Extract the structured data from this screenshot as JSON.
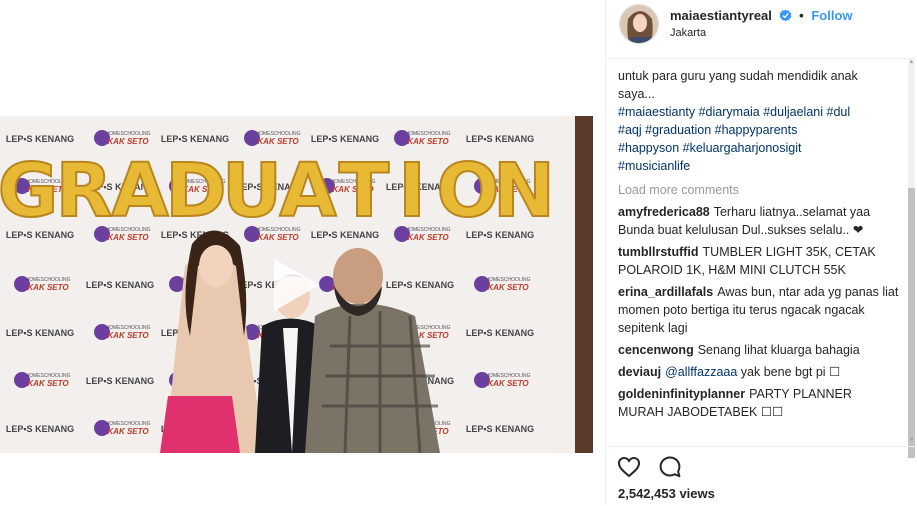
{
  "header": {
    "username": "maiaestiantyreal",
    "separator": "•",
    "follow_label": "Follow",
    "location": "Jakarta"
  },
  "caption": {
    "line1": "untuk para guru yang sudah mendidik anak",
    "line2": "saya...",
    "hashtag_lines": [
      [
        "#maiaestianty",
        "#diarymaia",
        "#duljaelani",
        "#dul"
      ],
      [
        "#aqj",
        "#graduation",
        "#happyparents"
      ],
      [
        "#happyson",
        "#keluargaharjonosigit"
      ],
      [
        "#musicianlife"
      ]
    ]
  },
  "load_more_label": "Load more comments",
  "comments": [
    {
      "user": "amyfrederica88",
      "text": "Terharu liatnya..selamat yaa Bunda buat kelulusan Dul..sukses selalu.. ❤"
    },
    {
      "user": "tumbllrstuffid",
      "text": "TUMBLER LIGHT 35K, CETAK POLAROID 1K, H&M MINI CLUTCH 55K"
    },
    {
      "user": "erina_ardillafals",
      "text": "Awas bun, ntar ada yg panas liat momen poto bertiga itu terus ngacak ngacak sepitenk lagi"
    },
    {
      "user": "cencenwong",
      "text": "Senang lihat kluarga bahagia"
    },
    {
      "user": "deviauj",
      "mention": "@allffazzaaa",
      "text": "yak bene bgt pi ☐"
    },
    {
      "user": "goldeninfinityplanner",
      "text": "PARTY PLANNER MURAH JABODETABEK ☐☐"
    }
  ],
  "actions": {
    "like_icon": "heart-icon",
    "comment_icon": "comment-icon"
  },
  "views_label": "2,542,453 views",
  "video": {
    "balloon_text": "GRADUATION",
    "backdrop_logo_1": "LEP•S KENANG",
    "backdrop_logo_2": "HOMESCHOOLING KAK SETO",
    "backdrop_logo_2_line1": "HOMESCHOOLING",
    "backdrop_logo_2_line2": "KAK SETO"
  },
  "colors": {
    "link_blue": "#3897f0",
    "hashtag_navy": "#003569",
    "balloon_gold": "#e7b934",
    "logo_purple": "#6b3fa0",
    "logo_red": "#c0392b"
  }
}
